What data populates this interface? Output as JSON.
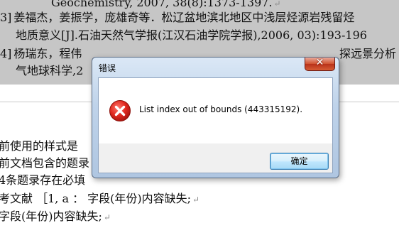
{
  "document": {
    "reference_lines": [
      {
        "text": "Geochemistry, 2007, 38(8):1373-1397."
      },
      {
        "num": "3]",
        "text": "姜福杰，姜振学，庞雄奇等．松辽盆地滨北地区中浅层烃源岩残留烃"
      },
      {
        "text": "地质意义[J].石油天然气学报(江汉石油学院学报),2006, 03):193-196"
      },
      {
        "num": "4]",
        "text": "杨瑞东，程伟"
      },
      {
        "text": "气地球科学,2"
      }
    ],
    "right_snippet": "探远景分析",
    "body_lines": [
      {
        "text": "前使用的样式是"
      },
      {
        "text": "前文档包含的题录"
      },
      {
        "text": "4条题录存在必填"
      },
      {
        "text": "考文献  ［1, a ： 字段(年份)内容缺失;"
      },
      {
        "text": "字段(年份)内容缺失;"
      }
    ],
    "para_mark": "↵"
  },
  "dialog": {
    "title": "错误",
    "close_symbol": "✕",
    "message": "List index out of bounds (443315192).",
    "ok_label": "确定",
    "icon": "error-icon"
  },
  "colors": {
    "highlight": "#c6c6c6",
    "error_red": "#d9251d"
  }
}
